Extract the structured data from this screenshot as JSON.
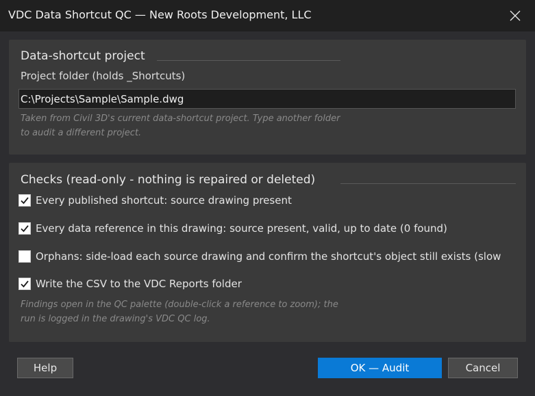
{
  "window": {
    "title": "VDC Data Shortcut QC — New Roots Development, LLC",
    "close_icon": "close-icon"
  },
  "project": {
    "heading": "Data-shortcut project",
    "folder_label": "Project folder (holds _Shortcuts)",
    "folder_value": "C:\\Projects\\Sample\\Sample.dwg",
    "hint_line1": "Taken from Civil 3D's current data-shortcut project. Type another folder",
    "hint_line2": "to audit a different project."
  },
  "checks": {
    "heading": "Checks (read-only - nothing is repaired or deleted)",
    "items": [
      {
        "label": "Every published shortcut: source drawing present",
        "checked": true
      },
      {
        "label": "Every data reference in this drawing: source present, valid, up to date (0 found)",
        "checked": true
      },
      {
        "label": "Orphans: side-load each source drawing and confirm the shortcut's object still exists (slow",
        "checked": false
      },
      {
        "label": "Write the CSV to the VDC Reports folder",
        "checked": true
      }
    ],
    "hint_line1": "Findings open in the QC palette (double-click a reference to zoom); the",
    "hint_line2": "run is logged in the drawing's VDC QC log."
  },
  "buttons": {
    "help": "Help",
    "ok": "OK — Audit",
    "cancel": "Cancel"
  },
  "colors": {
    "accent": "#0a7ad6",
    "background": "#2d2d30",
    "panel": "#3a3a3a",
    "titlebar": "#202020"
  }
}
